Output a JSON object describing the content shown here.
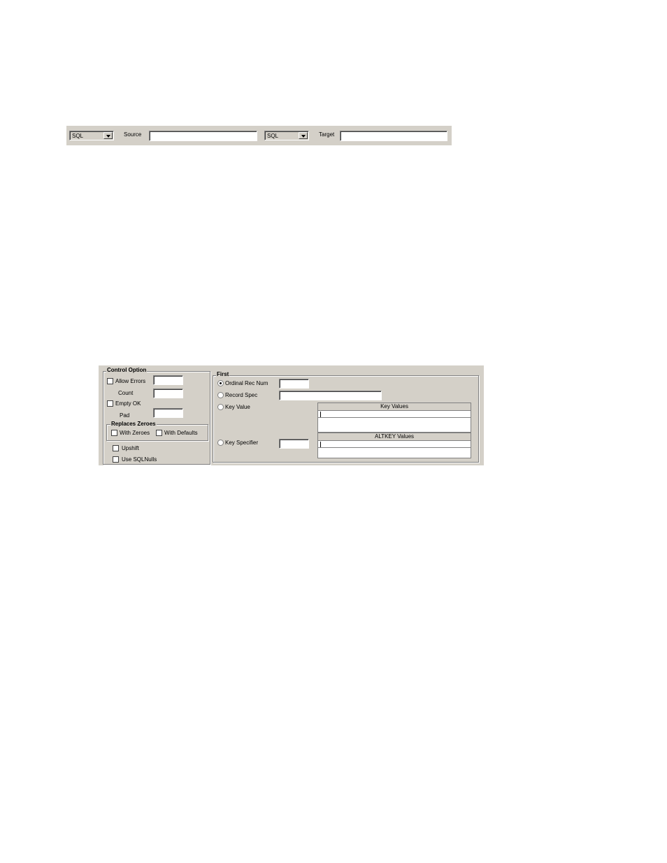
{
  "toolbar": {
    "source_type": "SQL",
    "source_label": "Source",
    "source_value": "",
    "target_type": "SQL",
    "target_label": "Target",
    "target_value": ""
  },
  "control_option": {
    "title": "Control Option",
    "allow_errors": {
      "label": "Allow Errors",
      "checked": false
    },
    "count_label": "Count",
    "empty_ok": {
      "label": "Empty OK",
      "checked": false
    },
    "pad_label": "Pad",
    "replaces_zeroes": {
      "title": "Replaces Zeroes",
      "with_zeroes": "With Zeroes",
      "with_defaults": "With Defaults"
    },
    "upshift": "Upshift",
    "use_sql_nulls": "Use SQLNulls"
  },
  "first": {
    "title": "First",
    "ordinal_rec_num": "Ordinal Rec Num",
    "record_spec": "Record Spec",
    "key_value": "Key Value",
    "key_specifier": "Key Specifier",
    "key_values_header": "Key Values",
    "altkey_values_header": "ALTKEY Values",
    "selected": "ordinal_rec_num"
  }
}
